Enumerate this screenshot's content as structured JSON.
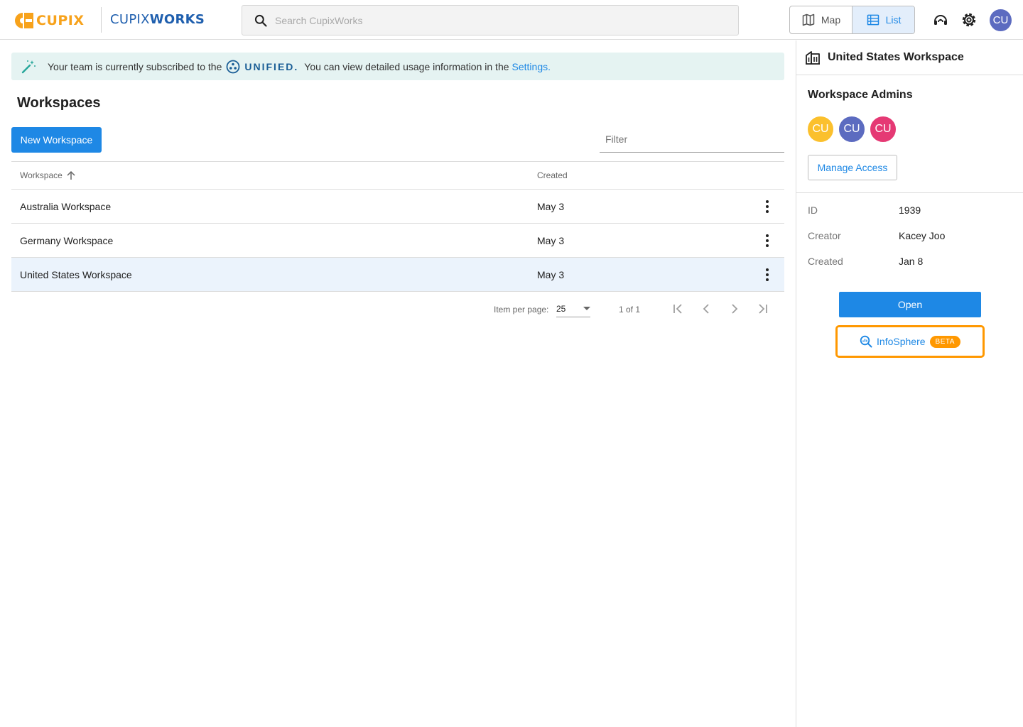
{
  "header": {
    "logo_text": "CUPIX",
    "product_light": "CUPIX",
    "product_bold": "WORKS",
    "search_placeholder": "Search CupixWorks",
    "view_map_label": "Map",
    "view_list_label": "List",
    "user_initials": "CU",
    "colors": {
      "brand_orange": "#f7a21b",
      "brand_blue": "#1f5fae",
      "accent": "#1e88e5"
    },
    "icons": [
      "search-icon",
      "map-icon",
      "list-icon",
      "support-icon",
      "gear-icon"
    ]
  },
  "banner": {
    "text_before": "Your team is currently subscribed to the",
    "plan_name": "UNIFIED.",
    "text_after": "You can view detailed usage information in the",
    "link_text": "Settings."
  },
  "workspaces": {
    "title": "Workspaces",
    "new_button_label": "New Workspace",
    "filter_placeholder": "Filter",
    "columns": {
      "name": "Workspace",
      "created": "Created"
    },
    "rows": [
      {
        "name": "Australia Workspace",
        "created": "May 3",
        "selected": false
      },
      {
        "name": "Germany Workspace",
        "created": "May 3",
        "selected": false
      },
      {
        "name": "United States Workspace",
        "created": "May 3",
        "selected": true
      }
    ],
    "pagination": {
      "items_per_page_label": "Item per page:",
      "items_per_page": "25",
      "range": "1 of 1"
    }
  },
  "detail": {
    "title": "United States Workspace",
    "admins_label": "Workspace Admins",
    "admins": [
      {
        "initials": "CU",
        "color": "#fbc02d"
      },
      {
        "initials": "CU",
        "color": "#5c6bc0"
      },
      {
        "initials": "CU",
        "color": "#e53974"
      }
    ],
    "manage_access_label": "Manage Access",
    "info": {
      "id_label": "ID",
      "id_value": "1939",
      "creator_label": "Creator",
      "creator_value": "Kacey Joo",
      "created_label": "Created",
      "created_value": "Jan 8"
    },
    "open_label": "Open",
    "infosphere_label": "InfoSphere",
    "infosphere_badge": "BETA"
  }
}
